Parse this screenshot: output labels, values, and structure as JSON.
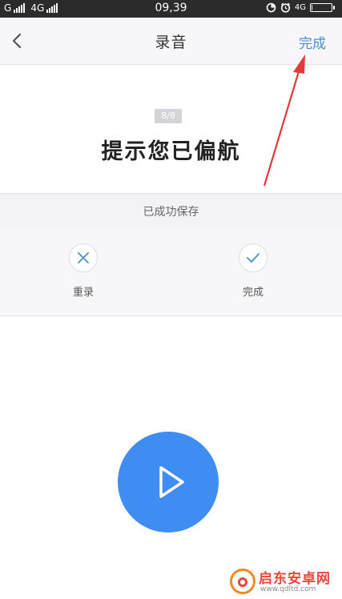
{
  "status_bar": {
    "carrier1": "G",
    "carrier2": "4G",
    "time": "09,39",
    "network_right": "4G",
    "battery_level": 0.05
  },
  "nav": {
    "title": "录音",
    "done_label": "完成",
    "back_icon": "chevron-left-icon"
  },
  "prompt": {
    "counter": "8/8",
    "text": "提示您已偏航"
  },
  "saved": {
    "message": "已成功保存"
  },
  "actions": {
    "rerecord_label": "重录",
    "rerecord_icon": "close-icon",
    "done_label": "完成",
    "done_icon": "check-icon"
  },
  "player": {
    "play_icon": "play-icon"
  },
  "colors": {
    "accent": "#4a8fd0",
    "play_button": "#3f8df2",
    "annotation_arrow": "#e03a3a"
  },
  "watermark": {
    "name": "启东安卓网",
    "url": "www.qdltd.com"
  }
}
